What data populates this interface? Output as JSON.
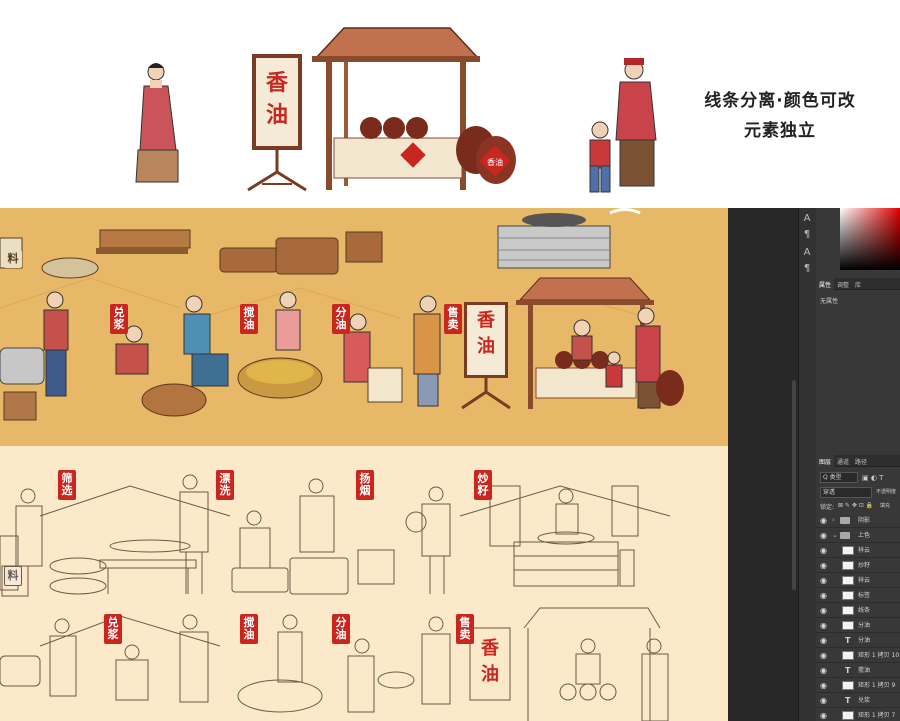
{
  "banner": {
    "caption_line1": "线条分离·颜色可改",
    "caption_line2": "元素独立",
    "sign_chars": [
      "香",
      "油"
    ],
    "jar_label": "香油"
  },
  "color_section": {
    "labels": [
      "兑浆",
      "搅油",
      "分油",
      "售卖"
    ],
    "sign_chars": [
      "香",
      "油"
    ],
    "sack_label": "料"
  },
  "line_section": {
    "labels_row1": [
      "筛选",
      "漂洗",
      "扬烟",
      "炒籽"
    ],
    "labels_row2": [
      "兑浆",
      "搅油",
      "分油",
      "售卖"
    ],
    "sign_chars": [
      "香",
      "油"
    ],
    "sack_label": "料"
  },
  "photoshop": {
    "panel_tabs_top": [
      "属性",
      "调整",
      "库"
    ],
    "properties_label": "无属性",
    "layers_tabs": [
      "图层",
      "通道",
      "路径"
    ],
    "filter_label": "Q 类型",
    "blend_mode": "穿透",
    "opacity_label": "不透明度",
    "lock_label": "锁定:",
    "fill_label": "填充",
    "layers": [
      {
        "type": "folder",
        "name": "阴影"
      },
      {
        "type": "folder",
        "name": "上色"
      },
      {
        "type": "image",
        "name": "祥云"
      },
      {
        "type": "image",
        "name": "炒籽"
      },
      {
        "type": "image",
        "name": "祥云"
      },
      {
        "type": "image",
        "name": "标签"
      },
      {
        "type": "image",
        "name": "线条"
      },
      {
        "type": "image",
        "name": "分油"
      },
      {
        "type": "text",
        "name": "分油"
      },
      {
        "type": "image",
        "name": "矩形 1 拷贝 10"
      },
      {
        "type": "text",
        "name": "搅油"
      },
      {
        "type": "image",
        "name": "矩形 1 拷贝 9"
      },
      {
        "type": "text",
        "name": "兑浆"
      },
      {
        "type": "image",
        "name": "矩形 1 拷贝 7"
      }
    ],
    "colors": {
      "panel": "#383838",
      "dark": "#282828"
    }
  }
}
